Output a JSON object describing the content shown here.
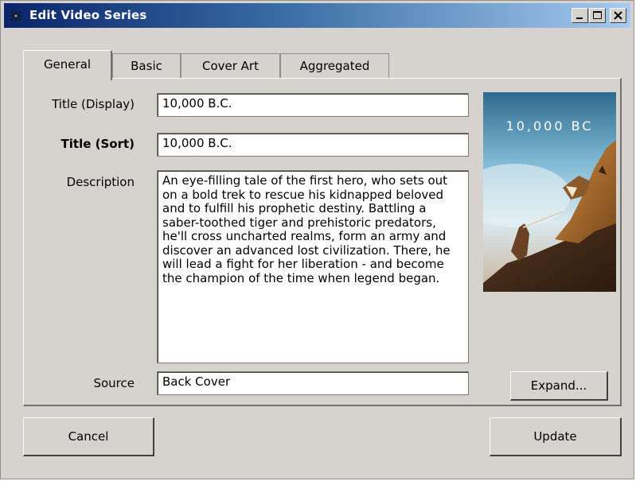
{
  "window": {
    "title": "Edit Video Series",
    "controls": {
      "minimize": "minimize",
      "maximize": "maximize",
      "close": "close"
    }
  },
  "tabs": [
    {
      "label": "General",
      "active": true
    },
    {
      "label": "Basic",
      "active": false
    },
    {
      "label": "Cover Art",
      "active": false
    },
    {
      "label": "Aggregated",
      "active": false
    }
  ],
  "form": {
    "title_display_label": "Title (Display)",
    "title_display_value": "10,000 B.C.",
    "title_sort_label": "Title (Sort)",
    "title_sort_value": "10,000 B.C.",
    "description_label": "Description",
    "description_value": "An eye-filling tale of the first hero, who sets out on a bold trek to rescue his kidnapped beloved and to fulfill his prophetic destiny. Battling a saber-toothed tiger and prehistoric predators, he'll cross uncharted realms, form an army and discover an advanced lost civilization. There, he will lead a fight for her liberation - and become the champion of the time when legend began.",
    "source_label": "Source",
    "source_value": "Back Cover"
  },
  "cover": {
    "title_text": "10,000 BC",
    "icon": "movie-poster-image"
  },
  "buttons": {
    "expand": "Expand...",
    "cancel": "Cancel",
    "update": "Update"
  },
  "colors": {
    "titlebar_start": "#0a246a",
    "titlebar_end": "#a6caf0",
    "dialog_bg": "#d6d3ce"
  }
}
